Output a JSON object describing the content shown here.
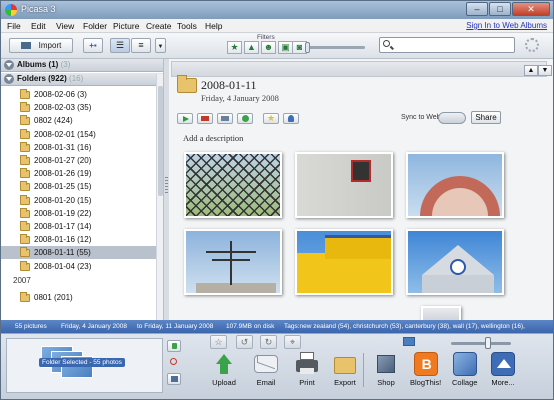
{
  "window": {
    "title": "Picasa 3"
  },
  "menu": [
    "File",
    "Edit",
    "View",
    "Folder",
    "Picture",
    "Create",
    "Tools",
    "Help"
  ],
  "signin": "Sign In to Web Albums",
  "toolbar": {
    "import_label": "Import",
    "filters_label": "Filters"
  },
  "sidebar": {
    "albums_label": "Albums (1)",
    "albums_count": "(3)",
    "folders_label": "Folders (922)",
    "folders_count": "(16)",
    "folders": [
      "2008-02-06 (3)",
      "2008-02-03 (35)",
      "0802 (424)",
      "2008-02-01 (154)",
      "2008-01-31 (16)",
      "2008-01-27 (20)",
      "2008-01-26 (19)",
      "2008-01-25 (15)",
      "2008-01-20 (15)",
      "2008-01-19 (22)",
      "2008-01-17 (14)",
      "2008-01-16 (12)",
      "2008-01-11 (55)",
      "2008-01-04 (23)"
    ],
    "selected_index": 12,
    "year_label": "2007",
    "folders_2007": [
      "0801 (201)"
    ]
  },
  "folder_view": {
    "title": "2008-01-11",
    "date": "Friday, 4 January 2008",
    "sync_label": "Sync to Web",
    "share_label": "Share",
    "description_placeholder": "Add a description"
  },
  "photos": [
    {
      "subject": "chain-link fence"
    },
    {
      "subject": "white wall with red window"
    },
    {
      "subject": "red arched facade"
    },
    {
      "subject": "tv antenna"
    },
    {
      "subject": "yellow building"
    },
    {
      "subject": "blue gable roof"
    }
  ],
  "status": {
    "pictures": "55 pictures",
    "from": "Friday, 4 January 2008",
    "to": "to Friday, 11 January 2008",
    "disk": "107.9MB on disk",
    "tags": "Tags:new zealand (54), christchurch (53), canterbury (38), wall (17), wellington (16),"
  },
  "tray": {
    "selection_label": "Folder Selected - 55 photos"
  },
  "actions": [
    {
      "label": "Upload",
      "color": "#3aa34a"
    },
    {
      "label": "Email",
      "color": "#d9dde3"
    },
    {
      "label": "Print",
      "color": "#555a61"
    },
    {
      "label": "Export",
      "color": "#e8c36c"
    },
    {
      "label": "Shop",
      "color": "#5a6f86"
    },
    {
      "label": "BlogThis!",
      "color": "#f07a22"
    },
    {
      "label": "Collage",
      "color": "#4f7fc0"
    },
    {
      "label": "More...",
      "color": "#3f6db5"
    }
  ]
}
